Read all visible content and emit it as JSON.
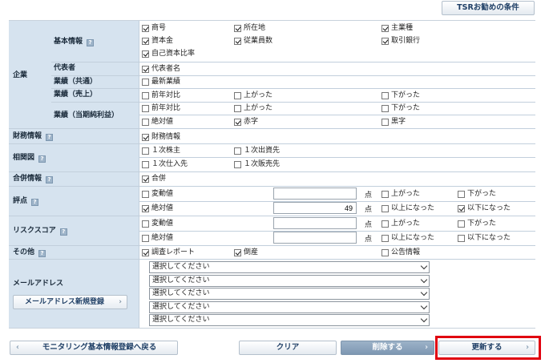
{
  "top_button": "TSRお勧めの条件",
  "help_icon": "?",
  "labels": {
    "kigyo": "企業",
    "kihon": "基本情報",
    "daihyo": "代表者",
    "gyoseki": "業績（共通）",
    "uriage": "業績（売上）",
    "junrieki": "業績（当期純利益）",
    "zaimu": "財務情報",
    "sokan": "相関図",
    "gappei": "合併情報",
    "hyoten": "評点",
    "risk": "リスクスコア",
    "sonota": "その他",
    "mail": "メールアドレス"
  },
  "checks": {
    "shogo": "商号",
    "shozaichi": "所在地",
    "shugyoshu": "主業種",
    "shihonkin": "資本金",
    "jugyoin": "従業員数",
    "torihiki": "取引銀行",
    "jiko": "自己資本比率",
    "daihyosha": "代表者名",
    "saishin": "最新業績",
    "zennen": "前年対比",
    "agatta": "上がった",
    "sagatta": "下がった",
    "zettai": "絶対値",
    "akaji": "赤字",
    "kuroji": "黒字",
    "zaimu": "財務情報",
    "kabunushi": "１次株主",
    "shusshi": "１次出資先",
    "shiire": "１次仕入先",
    "hanbai": "１次販売先",
    "gappei": "合併",
    "hendo": "変動値",
    "ijo": "以上になった",
    "ika": "以下になった",
    "chosa": "調査レポート",
    "tosan": "倒産",
    "kokoku": "公告情報"
  },
  "inputs": {
    "hyoten_hendo": "",
    "hyoten_zettai": "49",
    "risk_hendo": "",
    "risk_zettai": ""
  },
  "unit": "点",
  "mail_select_placeholder": "選択してください",
  "mail_register_button": "メールアドレス新規登録",
  "buttons": {
    "back": "モニタリング基本情報登録へ戻る",
    "clear": "クリア",
    "delete": "削除する",
    "update": "更新する"
  },
  "colors": {
    "label_bg": "#d6e3ef",
    "accent_frame": "#e0000f",
    "disabled_button": "#8ea6be"
  }
}
